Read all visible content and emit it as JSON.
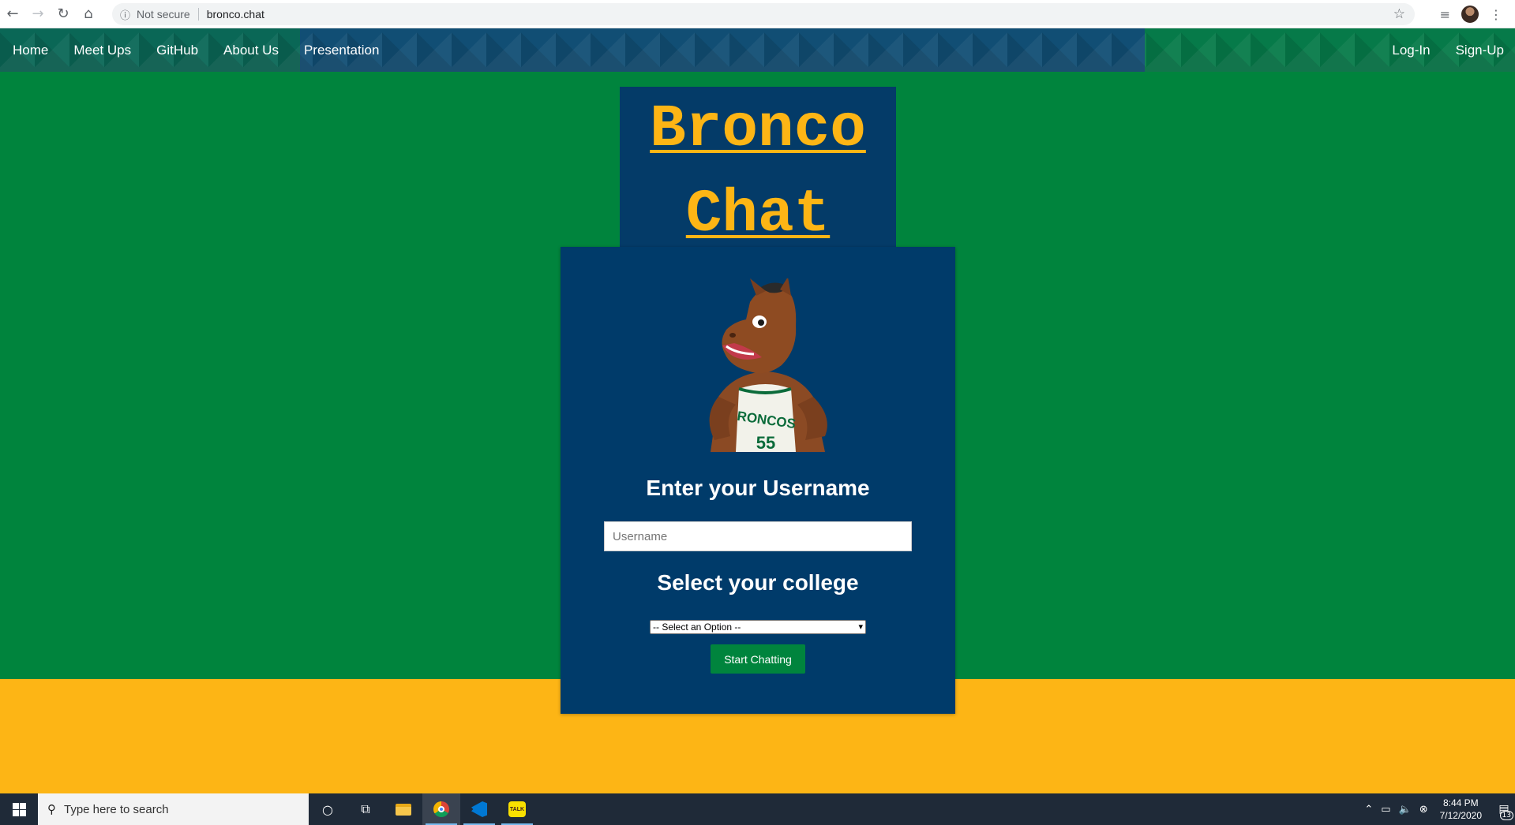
{
  "browser": {
    "security_label": "Not secure",
    "url": "bronco.chat"
  },
  "navbar": {
    "left_links": [
      "Home",
      "Meet Ups",
      "GitHub",
      "About Us",
      "Presentation"
    ],
    "right_links": [
      "Log-In",
      "Sign-Up"
    ]
  },
  "title": {
    "line1": "Bronco",
    "line2": "Chat"
  },
  "form": {
    "username_heading": "Enter your Username",
    "username_placeholder": "Username",
    "college_heading": "Select your college",
    "college_selected": "-- Select an Option --",
    "start_button": "Start Chatting"
  },
  "taskbar": {
    "search_placeholder": "Type here to search",
    "time": "8:44 PM",
    "date": "7/12/2020",
    "notification_count": "13",
    "talk_label": "TALK"
  },
  "colors": {
    "green": "#00843d",
    "gold": "#fdb515",
    "navy": "#003b6a"
  }
}
